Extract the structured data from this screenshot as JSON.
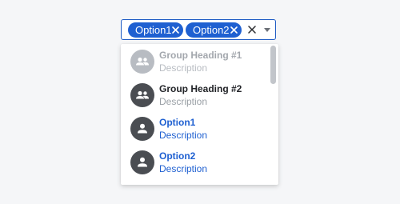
{
  "combobox": {
    "chips": [
      {
        "label": "Option1"
      },
      {
        "label": "Option2"
      }
    ],
    "icons": {
      "chip_remove": "close-icon",
      "clear": "close-icon",
      "toggle": "caret-down-icon"
    }
  },
  "dropdown": {
    "items": [
      {
        "title": "Group Heading #1",
        "description": "Description",
        "icon": "group-icon",
        "state": "disabled"
      },
      {
        "title": "Group Heading #2",
        "description": "Description",
        "icon": "group-icon",
        "state": "default"
      },
      {
        "title": "Option1",
        "description": "Description",
        "icon": "person-icon",
        "state": "selected"
      },
      {
        "title": "Option2",
        "description": "Description",
        "icon": "person-icon",
        "state": "selected"
      }
    ]
  },
  "colors": {
    "accent": "#1f60d1",
    "avatar": "#4a4d52",
    "avatar_disabled": "#b8bcc2",
    "background": "#f5f6f8"
  }
}
